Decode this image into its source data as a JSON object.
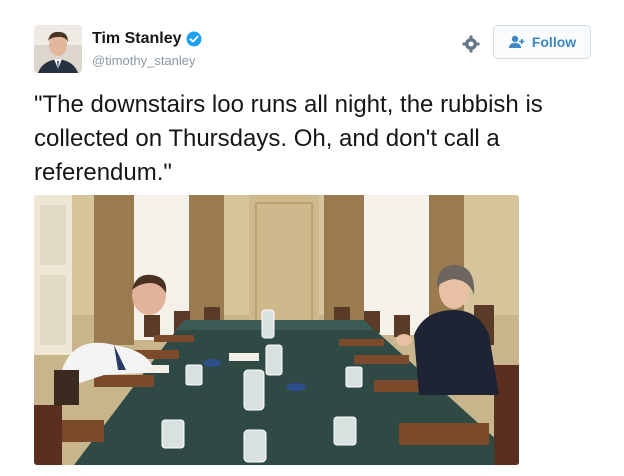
{
  "tweet": {
    "author_name": "Tim Stanley",
    "author_handle": "@timothy_stanley",
    "text": "\"The downstairs loo runs all night, the rubbish is collected on Thursdays. Oh, and don't call a referendum.\"",
    "verified": true
  },
  "actions": {
    "follow_label": "Follow"
  },
  "icons": {
    "verified": "verified-badge-icon",
    "settings": "gear-icon",
    "follow": "add-user-icon"
  },
  "colors": {
    "accent": "#3b88c3",
    "verified": "#1da1f2",
    "handle": "#8899a6"
  }
}
